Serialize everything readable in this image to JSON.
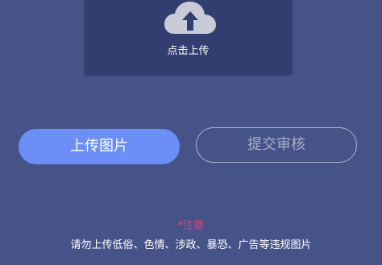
{
  "upload": {
    "label": "点击上传",
    "icon": "cloud-upload-icon"
  },
  "buttons": {
    "upload_image": "上传图片",
    "submit_review": "提交审核"
  },
  "notice": {
    "title": "*注意",
    "text": "请勿上传低俗、色情、涉政、暴恐、广告等违规图片"
  },
  "colors": {
    "background": "#465389",
    "card": "#323e70",
    "primary_button": "#6b8ff7",
    "notice_title": "#e8427a"
  }
}
